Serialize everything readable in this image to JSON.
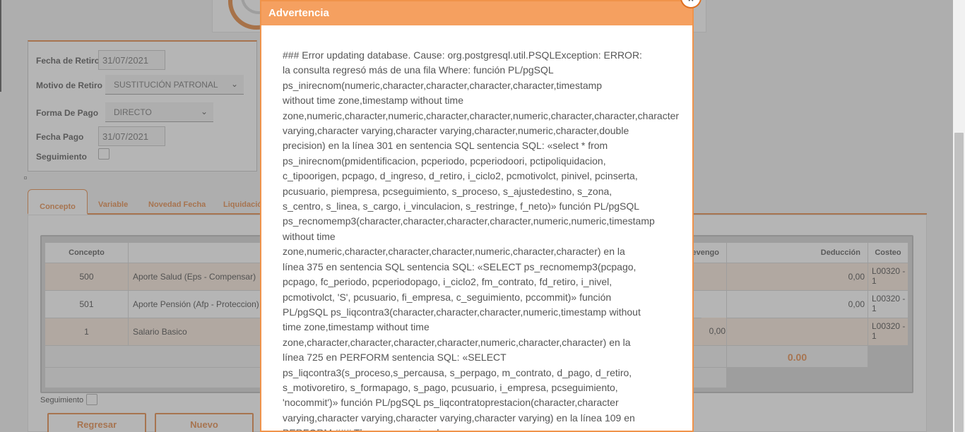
{
  "form": {
    "fecha_retiro_label": "Fecha de Retiro",
    "fecha_retiro_value": "31/07/2021",
    "motivo_label": "Motivo de Retiro",
    "motivo_value": "SUSTITUCIÓN PATRONAL",
    "forma_pago_label": "Forma De Pago",
    "forma_pago_value": "DIRECTO",
    "fecha_pago_label": "Fecha Pago",
    "fecha_pago_value": "31/07/2021",
    "seguimiento_label": "Seguimiento"
  },
  "tabs": [
    "Concepto",
    "Variable",
    "Novedad Fecha",
    "Liquidación"
  ],
  "table": {
    "headers": {
      "concepto": "Concepto",
      "devengo": "Devengo",
      "deduccion": "Deducción",
      "costeo": "Costeo"
    },
    "rows": [
      {
        "codigo": "500",
        "nombre": "Aporte Salud (Eps - Compensar)",
        "devengo": "",
        "deduccion": "0,00",
        "costeo": "L00320 -\n1"
      },
      {
        "codigo": "501",
        "nombre": "Aporte Pensión (Afp - Proteccion)",
        "devengo": "",
        "deduccion": "0,00",
        "costeo": "L00320 -\n1"
      },
      {
        "codigo": "1",
        "nombre": "Salario Basico",
        "devengo": "0,00",
        "deduccion": "",
        "costeo": "L00320 -\n1"
      }
    ],
    "total_deduccion": "0.00"
  },
  "bottom": {
    "seguimiento_label": "Seguimiento",
    "regresar": "Regresar",
    "nuevo": "Nuevo"
  },
  "modal": {
    "title": "Advertencia",
    "close": "×",
    "message": "### Error updating database. Cause: org.postgresql.util.PSQLException: ERROR:\nla consulta regresó más de una fila Where: función PL/pgSQL\nps_inirecnom(numeric,character,character,character,character,timestamp\nwithout time zone,timestamp without time\nzone,numeric,character,numeric,character,character,numeric,character,character,character\nvarying,character varying,character varying,character,numeric,character,double\nprecision) en la línea 301 en sentencia SQL sentencia SQL: «select * from\nps_inirecnom(pmidentificacion, pcperiodo, pcperiodoori, pctipoliquidacion,\nc_tipoorigen, pcpago, d_ingreso, d_retiro, i_ciclo2, pcmotivolct, pinivel, pcinserta,\npcusuario, piempresa, pcseguimiento, s_proceso, s_ajustedestino, s_zona,\ns_centro, s_linea, s_cargo, i_vinculacion, s_restringe, f_neto)» función PL/pgSQL\nps_recnomemp3(character,character,character,character,numeric,numeric,timestamp\nwithout time\nzone,numeric,character,character,character,numeric,character,character) en la\nlínea 375 en sentencia SQL sentencia SQL: «SELECT ps_recnomemp3(pcpago,\npcpago, fc_periodo, pcperiodopago, i_ciclo2, fm_contrato, fd_retiro, i_nivel,\npcmotivolct, 'S', pcusuario, fi_empresa, c_seguimiento, pccommit)» función\nPL/pgSQL ps_liqcontra3(character,character,character,numeric,timestamp without\ntime zone,timestamp without time\nzone,character,character,character,character,numeric,character,character) en la\nlínea 725 en PERFORM sentencia SQL: «SELECT\nps_liqcontra3(s_proceso,s_percausa, s_perpago, m_contrato, d_pago, d_retiro,\ns_motivoretiro, s_formapago, s_pago, pcusuario, i_empresa, pcseguimiento,\n'nocommit')» función PL/pgSQL ps_liqcontratoprestacion(character,character\nvarying,character varying,character varying,character varying) en la línea 109 en\nPERFORM ### The error may involve"
  }
}
